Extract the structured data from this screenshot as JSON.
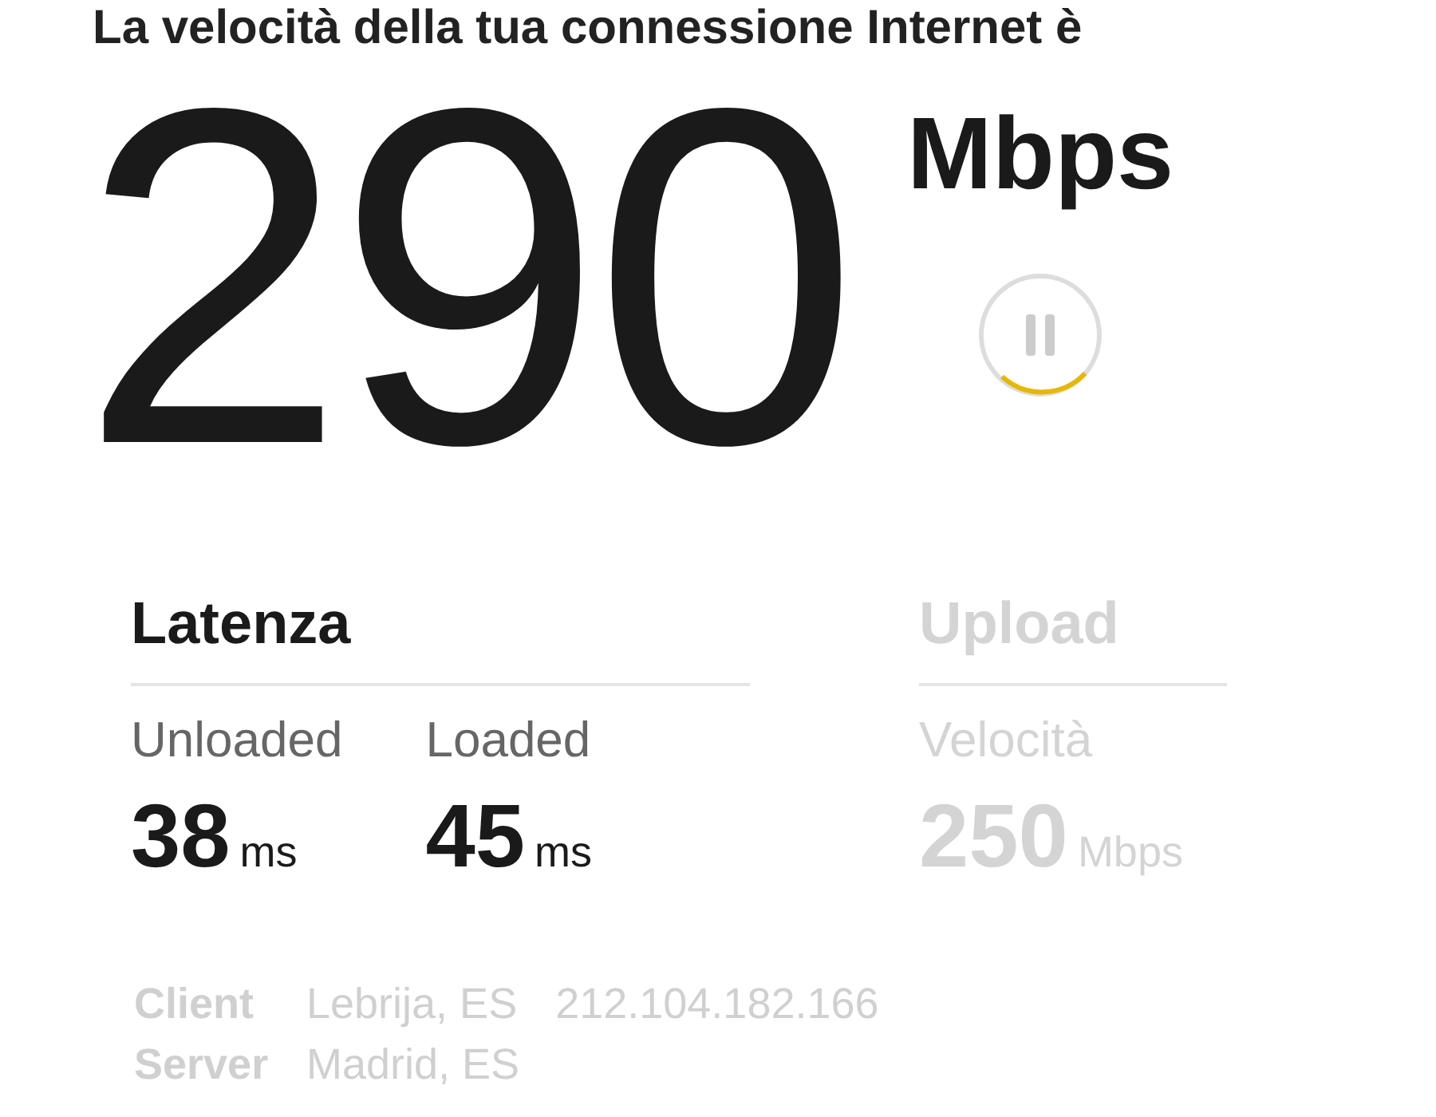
{
  "headline": "La velocità della tua connessione Internet è",
  "speed": {
    "value": "290",
    "unit": "Mbps"
  },
  "sections": [
    {
      "title": "Latenza",
      "dimmed": false,
      "metrics": [
        {
          "label": "Unloaded",
          "value": "38",
          "unit": "ms"
        },
        {
          "label": "Loaded",
          "value": "45",
          "unit": "ms"
        }
      ]
    },
    {
      "title": "Upload",
      "dimmed": true,
      "metrics": [
        {
          "label": "Velocità",
          "value": "250",
          "unit": "Mbps"
        }
      ]
    }
  ],
  "info": [
    {
      "label": "Client",
      "values": [
        "Lebrija, ES",
        "212.104.182.166"
      ]
    },
    {
      "label": "Server",
      "values": [
        "Madrid, ES"
      ]
    }
  ]
}
